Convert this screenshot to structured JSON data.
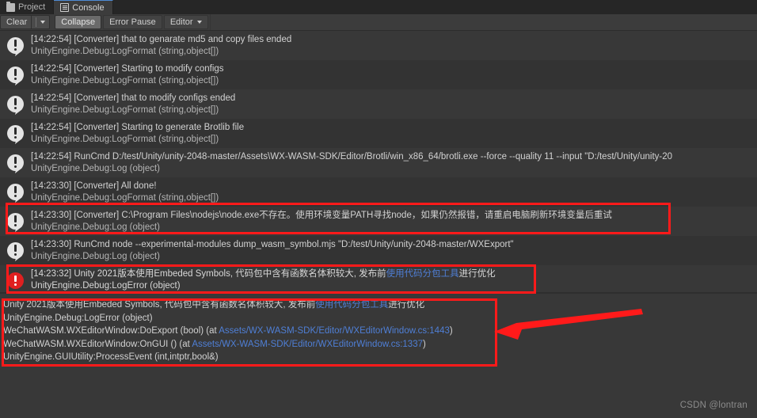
{
  "window": {
    "tabs": [
      {
        "label": "Project",
        "icon": "folder-icon",
        "active": false
      },
      {
        "label": "Console",
        "icon": "console-icon",
        "active": true
      }
    ]
  },
  "toolbar": {
    "clear_label": "Clear",
    "clear_dropdown_icon": "chevron-down-icon",
    "collapse_label": "Collapse",
    "error_pause_label": "Error Pause",
    "editor_label": "Editor",
    "editor_dropdown_icon": "chevron-down-icon"
  },
  "console": {
    "entries": [
      {
        "icon": "warning-icon",
        "message": "[14:22:54] [Converter] that to genarate md5 and copy files ended",
        "stack": "UnityEngine.Debug:LogFormat (string,object[])"
      },
      {
        "icon": "warning-icon",
        "message": "[14:22:54] [Converter] Starting to modify configs",
        "stack": "UnityEngine.Debug:LogFormat (string,object[])"
      },
      {
        "icon": "warning-icon",
        "message": "[14:22:54] [Converter] that to modify configs ended",
        "stack": "UnityEngine.Debug:LogFormat (string,object[])"
      },
      {
        "icon": "warning-icon",
        "message": "[14:22:54] [Converter] Starting to generate Brotlib file",
        "stack": "UnityEngine.Debug:LogFormat (string,object[])"
      },
      {
        "icon": "warning-icon",
        "message": "[14:22:54] RunCmd D:/test/Unity/unity-2048-master/Assets\\WX-WASM-SDK/Editor/Brotli/win_x86_64/brotli.exe  --force --quality 11 --input \"D:/test/Unity/unity-20",
        "stack": "UnityEngine.Debug:Log (object)"
      },
      {
        "icon": "warning-icon",
        "message": "[14:23:30] [Converter] All done!",
        "stack": "UnityEngine.Debug:LogFormat (string,object[])"
      },
      {
        "icon": "warning-icon",
        "message": "[14:23:30] [Converter] C:\\Program Files\\nodejs\\node.exe不存在。使用环境变量PATH寻找node，如果仍然报错，请重启电脑刷新环境变量后重试",
        "stack": "UnityEngine.Debug:Log (object)"
      },
      {
        "icon": "warning-icon",
        "message": "[14:23:30] RunCmd node --experimental-modules dump_wasm_symbol.mjs \"D:/test/Unity/unity-2048-master/WXExport\"",
        "stack": "UnityEngine.Debug:Log (object)"
      },
      {
        "icon": "error-icon",
        "message_pre": "[14:23:32] Unity 2021版本使用Embeded Symbols, 代码包中含有函数名体积较大, 发布前",
        "message_link": "使用代码分包工具",
        "message_post": "进行优化",
        "stack": "UnityEngine.Debug:LogError (object)"
      }
    ]
  },
  "detail": {
    "line1_pre": "Unity 2021版本使用Embeded Symbols, 代码包中含有函数名体积较大, 发布前",
    "line1_link": "使用代码分包工具",
    "line1_post": "进行优化",
    "line2": "UnityEngine.Debug:LogError (object)",
    "line3_pre": "WeChatWASM.WXEditorWindow:DoExport (bool) (at ",
    "line3_link": "Assets/WX-WASM-SDK/Editor/WXEditorWindow.cs:1443",
    "line3_post": ")",
    "line4_pre": "WeChatWASM.WXEditorWindow:OnGUI () (at ",
    "line4_link": "Assets/WX-WASM-SDK/Editor/WXEditorWindow.cs:1337",
    "line4_post": ")",
    "line5": "UnityEngine.GUIUtility:ProcessEvent (int,intptr,bool&)"
  },
  "watermark": "CSDN @lontran",
  "colors": {
    "annotation": "#ff1a1a",
    "link": "#4f7fd6",
    "error": "#e02020",
    "panel": "#383838",
    "toolbar": "#3c3c3c",
    "tabstrip": "#262626",
    "tab_accent": "#4e8ad4"
  }
}
